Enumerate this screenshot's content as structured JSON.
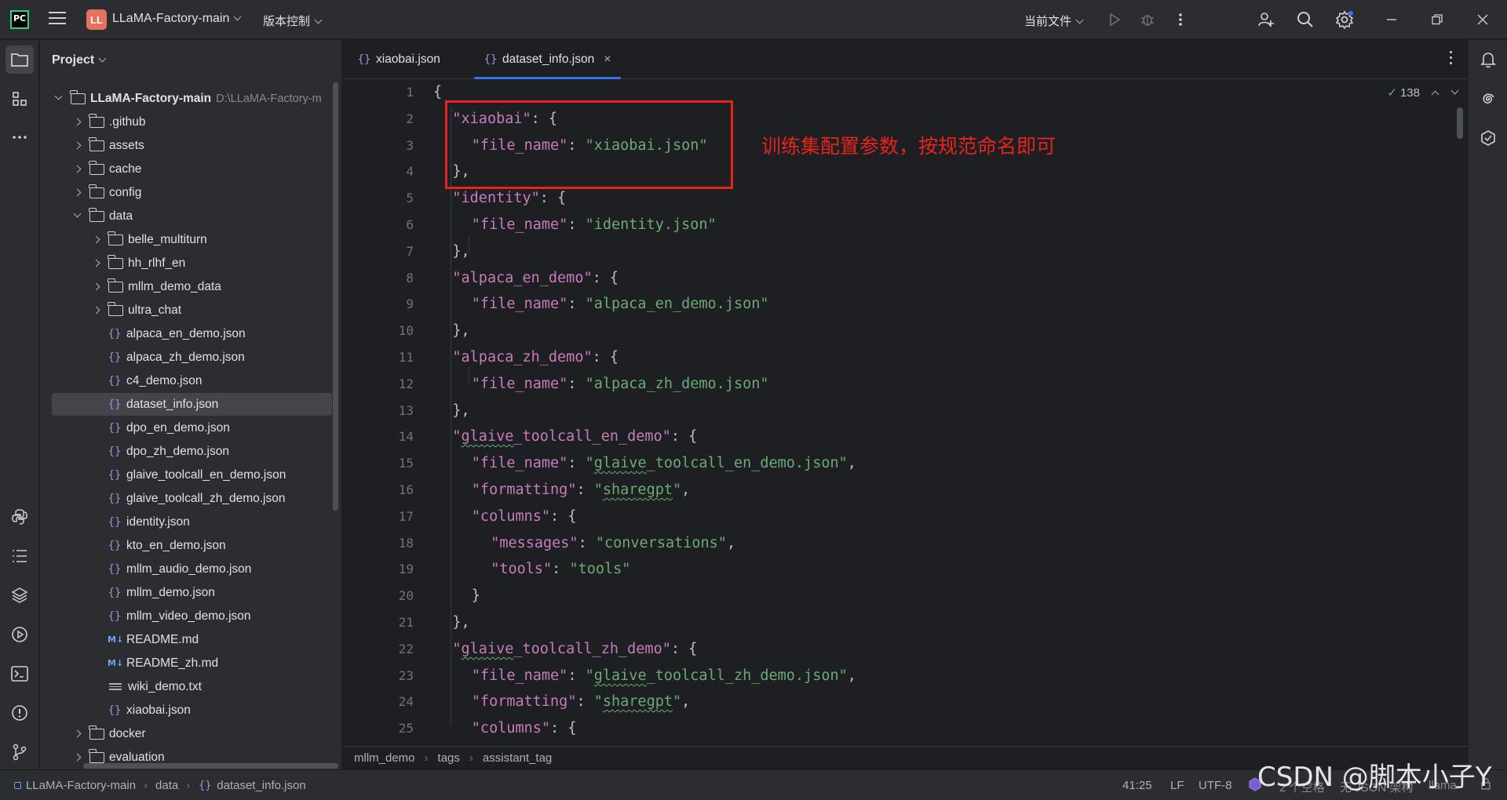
{
  "titlebar": {
    "logo_text": "PC",
    "project_badge": "LL",
    "project_name": "LLaMA-Factory-main",
    "vcs_menu": "版本控制",
    "run_config": "当前文件"
  },
  "project_panel": {
    "title": "Project",
    "root_name": "LLaMA-Factory-main",
    "root_path": "D:\\LLaMA-Factory-m",
    "items": [
      {
        "label": ".github",
        "kind": "folder",
        "depth": 1,
        "expanded": false
      },
      {
        "label": "assets",
        "kind": "folder",
        "depth": 1,
        "expanded": false
      },
      {
        "label": "cache",
        "kind": "folder",
        "depth": 1,
        "expanded": false
      },
      {
        "label": "config",
        "kind": "folder",
        "depth": 1,
        "expanded": false
      },
      {
        "label": "data",
        "kind": "folder",
        "depth": 1,
        "expanded": true
      },
      {
        "label": "belle_multiturn",
        "kind": "folder",
        "depth": 2,
        "expanded": false
      },
      {
        "label": "hh_rlhf_en",
        "kind": "folder",
        "depth": 2,
        "expanded": false
      },
      {
        "label": "mllm_demo_data",
        "kind": "folder",
        "depth": 2,
        "expanded": false
      },
      {
        "label": "ultra_chat",
        "kind": "folder",
        "depth": 2,
        "expanded": false
      },
      {
        "label": "alpaca_en_demo.json",
        "kind": "json",
        "depth": 2
      },
      {
        "label": "alpaca_zh_demo.json",
        "kind": "json",
        "depth": 2
      },
      {
        "label": "c4_demo.json",
        "kind": "json",
        "depth": 2
      },
      {
        "label": "dataset_info.json",
        "kind": "json",
        "depth": 2,
        "selected": true
      },
      {
        "label": "dpo_en_demo.json",
        "kind": "json",
        "depth": 2
      },
      {
        "label": "dpo_zh_demo.json",
        "kind": "json",
        "depth": 2
      },
      {
        "label": "glaive_toolcall_en_demo.json",
        "kind": "json",
        "depth": 2
      },
      {
        "label": "glaive_toolcall_zh_demo.json",
        "kind": "json",
        "depth": 2
      },
      {
        "label": "identity.json",
        "kind": "json",
        "depth": 2
      },
      {
        "label": "kto_en_demo.json",
        "kind": "json",
        "depth": 2
      },
      {
        "label": "mllm_audio_demo.json",
        "kind": "json",
        "depth": 2
      },
      {
        "label": "mllm_demo.json",
        "kind": "json",
        "depth": 2
      },
      {
        "label": "mllm_video_demo.json",
        "kind": "json",
        "depth": 2
      },
      {
        "label": "README.md",
        "kind": "md",
        "depth": 2
      },
      {
        "label": "README_zh.md",
        "kind": "md",
        "depth": 2
      },
      {
        "label": "wiki_demo.txt",
        "kind": "txt",
        "depth": 2
      },
      {
        "label": "xiaobai.json",
        "kind": "json",
        "depth": 2
      },
      {
        "label": "docker",
        "kind": "folder",
        "depth": 1,
        "expanded": false
      },
      {
        "label": "evaluation",
        "kind": "folder",
        "depth": 1,
        "expanded": false
      }
    ]
  },
  "editor": {
    "tabs": [
      {
        "label": "xiaobai.json",
        "active": false
      },
      {
        "label": "dataset_info.json",
        "active": true,
        "close": "×"
      }
    ],
    "inspection_count": "138",
    "annotation": "训练集配置参数，按规范命名即可",
    "lines": [
      {
        "n": "1",
        "indent": 0,
        "tokens": [
          [
            "p",
            "{"
          ]
        ]
      },
      {
        "n": "2",
        "indent": 1,
        "tokens": [
          [
            "k",
            "\"xiaobai\""
          ],
          [
            "p",
            ": {"
          ]
        ]
      },
      {
        "n": "3",
        "indent": 2,
        "tokens": [
          [
            "k",
            "\"file_name\""
          ],
          [
            "p",
            ": "
          ],
          [
            "s",
            "\"xiaobai.json\""
          ]
        ]
      },
      {
        "n": "4",
        "indent": 1,
        "tokens": [
          [
            "p",
            "},"
          ]
        ]
      },
      {
        "n": "5",
        "indent": 1,
        "tokens": [
          [
            "k",
            "\"identity\""
          ],
          [
            "p",
            ": {"
          ]
        ]
      },
      {
        "n": "6",
        "indent": 2,
        "tokens": [
          [
            "k",
            "\"file_name\""
          ],
          [
            "p",
            ": "
          ],
          [
            "s",
            "\"identity.json\""
          ]
        ]
      },
      {
        "n": "7",
        "indent": 1,
        "tokens": [
          [
            "p",
            "},"
          ]
        ]
      },
      {
        "n": "8",
        "indent": 1,
        "tokens": [
          [
            "k",
            "\"alpaca_en_demo\""
          ],
          [
            "p",
            ": {"
          ]
        ]
      },
      {
        "n": "9",
        "indent": 2,
        "tokens": [
          [
            "k",
            "\"file_name\""
          ],
          [
            "p",
            ": "
          ],
          [
            "s",
            "\"alpaca_en_demo.json\""
          ]
        ]
      },
      {
        "n": "10",
        "indent": 1,
        "tokens": [
          [
            "p",
            "},"
          ]
        ]
      },
      {
        "n": "11",
        "indent": 1,
        "tokens": [
          [
            "k",
            "\"alpaca_zh_demo\""
          ],
          [
            "p",
            ": {"
          ]
        ]
      },
      {
        "n": "12",
        "indent": 2,
        "tokens": [
          [
            "k",
            "\"file_name\""
          ],
          [
            "p",
            ": "
          ],
          [
            "s",
            "\"alpaca_zh_demo.json\""
          ]
        ]
      },
      {
        "n": "13",
        "indent": 1,
        "tokens": [
          [
            "p",
            "},"
          ]
        ]
      },
      {
        "n": "14",
        "indent": 1,
        "tokens": [
          [
            "k",
            "\""
          ],
          [
            "ku",
            "glaive"
          ],
          [
            "k",
            "_toolcall_en_demo\""
          ],
          [
            "p",
            ": {"
          ]
        ]
      },
      {
        "n": "15",
        "indent": 2,
        "tokens": [
          [
            "k",
            "\"file_name\""
          ],
          [
            "p",
            ": "
          ],
          [
            "s",
            "\""
          ],
          [
            "su",
            "glaive"
          ],
          [
            "s",
            "_toolcall_en_demo.json\""
          ],
          [
            "p",
            ","
          ]
        ]
      },
      {
        "n": "16",
        "indent": 2,
        "tokens": [
          [
            "k",
            "\"formatting\""
          ],
          [
            "p",
            ": "
          ],
          [
            "s",
            "\""
          ],
          [
            "su",
            "sharegpt"
          ],
          [
            "s",
            "\""
          ],
          [
            "p",
            ","
          ]
        ]
      },
      {
        "n": "17",
        "indent": 2,
        "tokens": [
          [
            "k",
            "\"columns\""
          ],
          [
            "p",
            ": {"
          ]
        ]
      },
      {
        "n": "18",
        "indent": 3,
        "tokens": [
          [
            "k",
            "\"messages\""
          ],
          [
            "p",
            ": "
          ],
          [
            "s",
            "\"conversations\""
          ],
          [
            "p",
            ","
          ]
        ]
      },
      {
        "n": "19",
        "indent": 3,
        "tokens": [
          [
            "k",
            "\"tools\""
          ],
          [
            "p",
            ": "
          ],
          [
            "s",
            "\"tools\""
          ]
        ]
      },
      {
        "n": "20",
        "indent": 2,
        "tokens": [
          [
            "p",
            "}"
          ]
        ]
      },
      {
        "n": "21",
        "indent": 1,
        "tokens": [
          [
            "p",
            "},"
          ]
        ]
      },
      {
        "n": "22",
        "indent": 1,
        "tokens": [
          [
            "k",
            "\""
          ],
          [
            "ku",
            "glaive"
          ],
          [
            "k",
            "_toolcall_zh_demo\""
          ],
          [
            "p",
            ": {"
          ]
        ]
      },
      {
        "n": "23",
        "indent": 2,
        "tokens": [
          [
            "k",
            "\"file_name\""
          ],
          [
            "p",
            ": "
          ],
          [
            "s",
            "\""
          ],
          [
            "su",
            "glaive"
          ],
          [
            "s",
            "_toolcall_zh_demo.json\""
          ],
          [
            "p",
            ","
          ]
        ]
      },
      {
        "n": "24",
        "indent": 2,
        "tokens": [
          [
            "k",
            "\"formatting\""
          ],
          [
            "p",
            ": "
          ],
          [
            "s",
            "\""
          ],
          [
            "su",
            "sharegpt"
          ],
          [
            "s",
            "\""
          ],
          [
            "p",
            ","
          ]
        ]
      },
      {
        "n": "25",
        "indent": 2,
        "tokens": [
          [
            "k",
            "\"columns\""
          ],
          [
            "p",
            ": {"
          ]
        ]
      }
    ],
    "breadcrumbs": [
      "mllm_demo",
      "tags",
      "assistant_tag"
    ]
  },
  "statusbar": {
    "path": [
      "LLaMA-Factory-main",
      "data",
      "dataset_info.json"
    ],
    "position": "41:25",
    "line_sep": "LF",
    "encoding": "UTF-8",
    "indent": "2 个空格",
    "schema": "无 JSON 架构",
    "interpreter": "llama"
  },
  "watermark": "CSDN @脚本小子Y",
  "colors": {
    "accent": "#3574f0",
    "annotation_red": "#e8231c",
    "json_key": "#c77dbb",
    "json_string": "#6aab73"
  }
}
